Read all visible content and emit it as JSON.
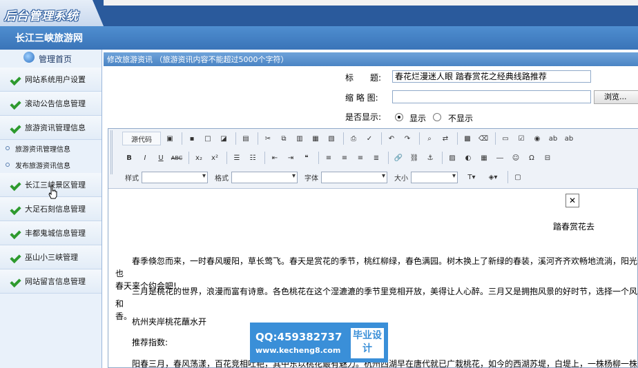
{
  "header": {
    "logo_text": "后台管理系统",
    "site_name": "长江三峡旅游网"
  },
  "sidebar": {
    "home_label": "管理首页",
    "items": [
      {
        "label": "网站系统用户设置"
      },
      {
        "label": "滚动公告信息管理"
      },
      {
        "label": "旅游资讯管理信息"
      }
    ],
    "sub_items": [
      {
        "label": "旅游资讯管理信息"
      },
      {
        "label": "发布旅游资讯信息"
      }
    ],
    "items2": [
      {
        "label": "长江三峡景区管理"
      },
      {
        "label": "大足石刻信息管理"
      },
      {
        "label": "丰都鬼城信息管理"
      },
      {
        "label": "巫山小三峡管理"
      },
      {
        "label": "网站留言信息管理"
      }
    ]
  },
  "main": {
    "panel_title": "修改旅游资讯 （旅游资讯内容不能超过5000个字符）",
    "title_label": "标　　题:",
    "title_value": "春花烂漫迷人眼 踏春赏花之经典线路推荐",
    "thumb_label": "缩 略 图:",
    "browse_label": "浏览...",
    "display_label": "是否显示:",
    "show_label": "显示",
    "hide_label": "不显示"
  },
  "editor": {
    "source_label": "源代码",
    "style_label": "样式",
    "format_label": "格式",
    "font_label": "字体",
    "size_label": "大小",
    "caption": "踏春赏花去",
    "paragraphs": [
      "　　春季倏忽而来，一时春风暖阳，草长莺飞。春天是赏花的季节，桃红柳绿，春色满园。树木换上了新绿的春装，溪河齐齐欢畅地流淌，阳光也\n春天来个约会吧!",
      "　　三月是桃花的世界，浪漫而富有诗意。各色桃花在这个湿漉漉的季节里竞相开放，美得让人心醉。三月又是拥抱风景的好时节，选择一个风和\n香。",
      "　　杭州夹岸桃花蘸水开",
      "　　推荐指数:",
      "　　阳春三月，春风荡漾，百花竞相吐艳，其中东以桃花最有魅力。杭州西湖早在唐代就已广栽桃花，如今的西湖苏堤，白堤上，一株杨柳一株桃"
    ]
  },
  "watermark": {
    "qq": "QQ:459382737",
    "url": "www.kecheng8.com",
    "badge": "毕业设计"
  },
  "colors": {
    "brand_dark": "#2a5a9c",
    "brand_band": "#4a84c4",
    "sidebar_bg": "#e9f1fa",
    "check_green": "#2e9a2e"
  }
}
